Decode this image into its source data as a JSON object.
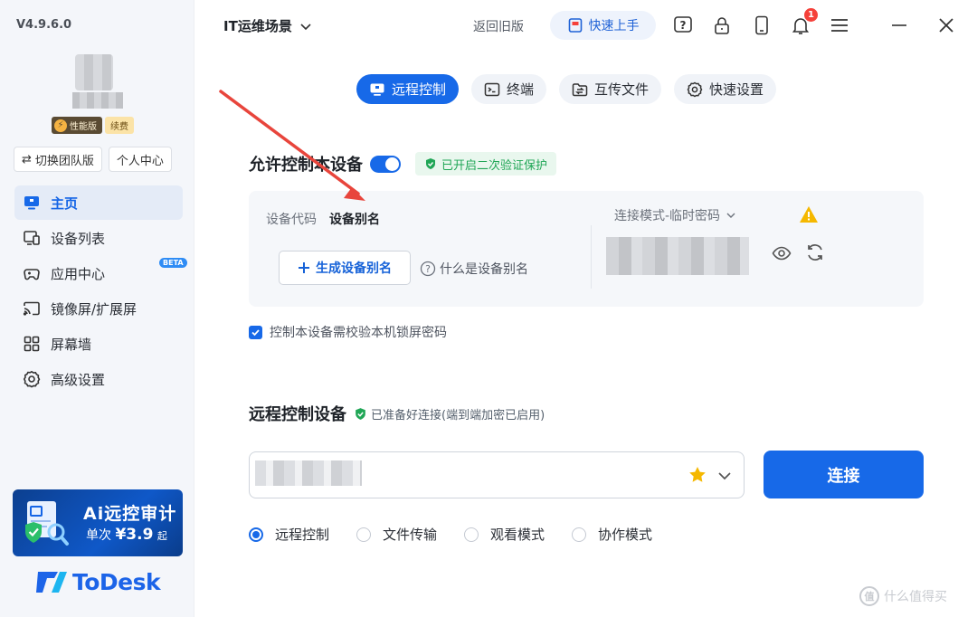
{
  "app": {
    "version": "V4.9.6.0",
    "scene_title": "IT运维场景",
    "old_version_link": "返回旧版",
    "quickstart_label": "快速上手",
    "notification_count": "1"
  },
  "account": {
    "vip_badge": "性能版",
    "renew_badge": "续费",
    "switch_team": "切换团队版",
    "personal_center": "个人中心"
  },
  "sidebar": {
    "items": [
      {
        "label": "主页",
        "icon": "monitor-icon",
        "active": true
      },
      {
        "label": "设备列表",
        "icon": "devices-icon"
      },
      {
        "label": "应用中心",
        "icon": "gamepad-icon",
        "badge": "BETA"
      },
      {
        "label": "镜像屏/扩展屏",
        "icon": "cast-icon"
      },
      {
        "label": "屏幕墙",
        "icon": "grid-icon"
      },
      {
        "label": "高级设置",
        "icon": "gear-icon"
      }
    ],
    "promo": {
      "title": "远控审计",
      "title_prefix": "Ai",
      "sub_prefix": "单次",
      "price": "¥3.9",
      "sub_suffix": "起"
    },
    "brand": "ToDesk"
  },
  "tabs": [
    {
      "label": "远程控制",
      "active": true
    },
    {
      "label": "终端"
    },
    {
      "label": "互传文件"
    },
    {
      "label": "快速设置"
    }
  ],
  "allow_control": {
    "title": "允许控制本设备",
    "enabled": true,
    "verify_badge": "已开启二次验证保护",
    "code_tab": "设备代码",
    "alias_tab": "设备别名",
    "gen_alias_button": "生成设备别名",
    "what_is_alias": "什么是设备别名",
    "connection_mode": "连接模式-临时密码",
    "lock_screen_check": "控制本设备需校验本机锁屏密码"
  },
  "remote": {
    "title": "远程控制设备",
    "ready_status": "已准备好连接(端到端加密已启用)",
    "connect_button": "连接",
    "modes": [
      {
        "label": "远程控制",
        "selected": true
      },
      {
        "label": "文件传输"
      },
      {
        "label": "观看模式"
      },
      {
        "label": "协作模式"
      }
    ]
  },
  "watermark": "什么值得买",
  "colors": {
    "accent": "#1769e8",
    "success": "#20a656",
    "warning": "#f5b800",
    "annotation": "#e8453c"
  }
}
